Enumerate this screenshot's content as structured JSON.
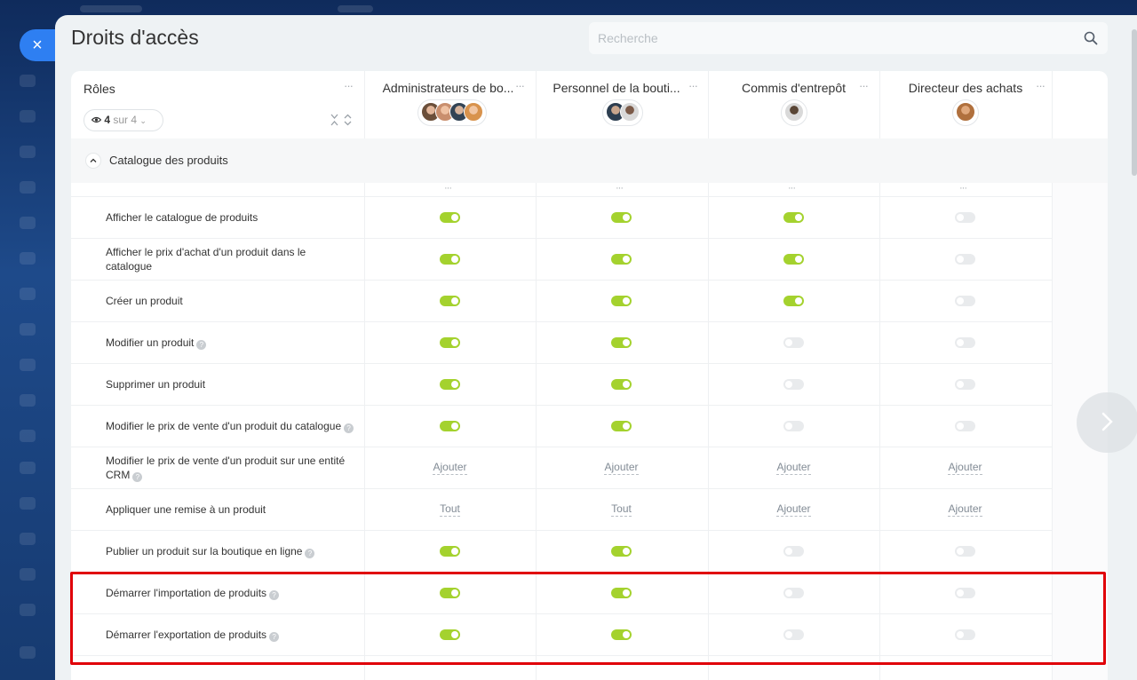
{
  "page": {
    "title": "Droits d'accès",
    "search_placeholder": "Recherche",
    "close_label": "×"
  },
  "header": {
    "roles_label": "Rôles",
    "filter": {
      "count": "4",
      "of": "sur 4"
    },
    "columns": [
      {
        "title": "Administrateurs de bo...",
        "avatar_colors": [
          "#6b4f3a",
          "#c98f6e",
          "#334455",
          "#d8934d"
        ]
      },
      {
        "title": "Personnel de la bouti...",
        "avatar_colors": [
          "#2d3e50",
          "#8a6b55"
        ]
      },
      {
        "title": "Commis d'entrepôt",
        "avatar_colors": [
          "#5a4636"
        ]
      },
      {
        "title": "Directeur des achats",
        "avatar_colors": [
          "#b0703d"
        ]
      }
    ]
  },
  "section": {
    "label": "Catalogue des produits"
  },
  "rows": [
    {
      "label": "Afficher le catalogue de produits",
      "help": false,
      "cells": [
        {
          "type": "toggle",
          "on": true
        },
        {
          "type": "toggle",
          "on": true
        },
        {
          "type": "toggle",
          "on": true
        },
        {
          "type": "toggle",
          "on": false
        }
      ]
    },
    {
      "label": "Afficher le prix d'achat d'un produit dans le catalogue",
      "help": false,
      "cells": [
        {
          "type": "toggle",
          "on": true
        },
        {
          "type": "toggle",
          "on": true
        },
        {
          "type": "toggle",
          "on": true
        },
        {
          "type": "toggle",
          "on": false
        }
      ]
    },
    {
      "label": "Créer un produit",
      "help": false,
      "cells": [
        {
          "type": "toggle",
          "on": true
        },
        {
          "type": "toggle",
          "on": true
        },
        {
          "type": "toggle",
          "on": true
        },
        {
          "type": "toggle",
          "on": false
        }
      ]
    },
    {
      "label": "Modifier un produit",
      "help": true,
      "cells": [
        {
          "type": "toggle",
          "on": true
        },
        {
          "type": "toggle",
          "on": true
        },
        {
          "type": "toggle",
          "on": false
        },
        {
          "type": "toggle",
          "on": false
        }
      ]
    },
    {
      "label": "Supprimer un produit",
      "help": false,
      "cells": [
        {
          "type": "toggle",
          "on": true
        },
        {
          "type": "toggle",
          "on": true
        },
        {
          "type": "toggle",
          "on": false
        },
        {
          "type": "toggle",
          "on": false
        }
      ]
    },
    {
      "label": "Modifier le prix de vente d'un produit du catalogue",
      "help": true,
      "cells": [
        {
          "type": "toggle",
          "on": true
        },
        {
          "type": "toggle",
          "on": true
        },
        {
          "type": "toggle",
          "on": false
        },
        {
          "type": "toggle",
          "on": false
        }
      ]
    },
    {
      "label": "Modifier le prix de vente d'un produit sur une entité CRM",
      "help": true,
      "cells": [
        {
          "type": "text",
          "value": "Ajouter"
        },
        {
          "type": "text",
          "value": "Ajouter"
        },
        {
          "type": "text",
          "value": "Ajouter"
        },
        {
          "type": "text",
          "value": "Ajouter"
        }
      ]
    },
    {
      "label": "Appliquer une remise à un produit",
      "help": false,
      "cells": [
        {
          "type": "text",
          "value": "Tout"
        },
        {
          "type": "text",
          "value": "Tout"
        },
        {
          "type": "text",
          "value": "Ajouter"
        },
        {
          "type": "text",
          "value": "Ajouter"
        }
      ]
    },
    {
      "label": "Publier un produit sur la boutique en ligne",
      "help": true,
      "cells": [
        {
          "type": "toggle",
          "on": true
        },
        {
          "type": "toggle",
          "on": true
        },
        {
          "type": "toggle",
          "on": false
        },
        {
          "type": "toggle",
          "on": false
        }
      ]
    },
    {
      "label": "Démarrer l'importation de produits",
      "help": true,
      "cells": [
        {
          "type": "toggle",
          "on": true
        },
        {
          "type": "toggle",
          "on": true
        },
        {
          "type": "toggle",
          "on": false
        },
        {
          "type": "toggle",
          "on": false
        }
      ]
    },
    {
      "label": "Démarrer l'exportation de produits",
      "help": true,
      "cells": [
        {
          "type": "toggle",
          "on": true
        },
        {
          "type": "toggle",
          "on": true
        },
        {
          "type": "toggle",
          "on": false
        },
        {
          "type": "toggle",
          "on": false
        }
      ]
    }
  ],
  "colors": {
    "toggle_on": "#a4d22e",
    "toggle_off": "#e9ebed",
    "highlight": "#e00009",
    "close_button": "#2e7ff2"
  }
}
